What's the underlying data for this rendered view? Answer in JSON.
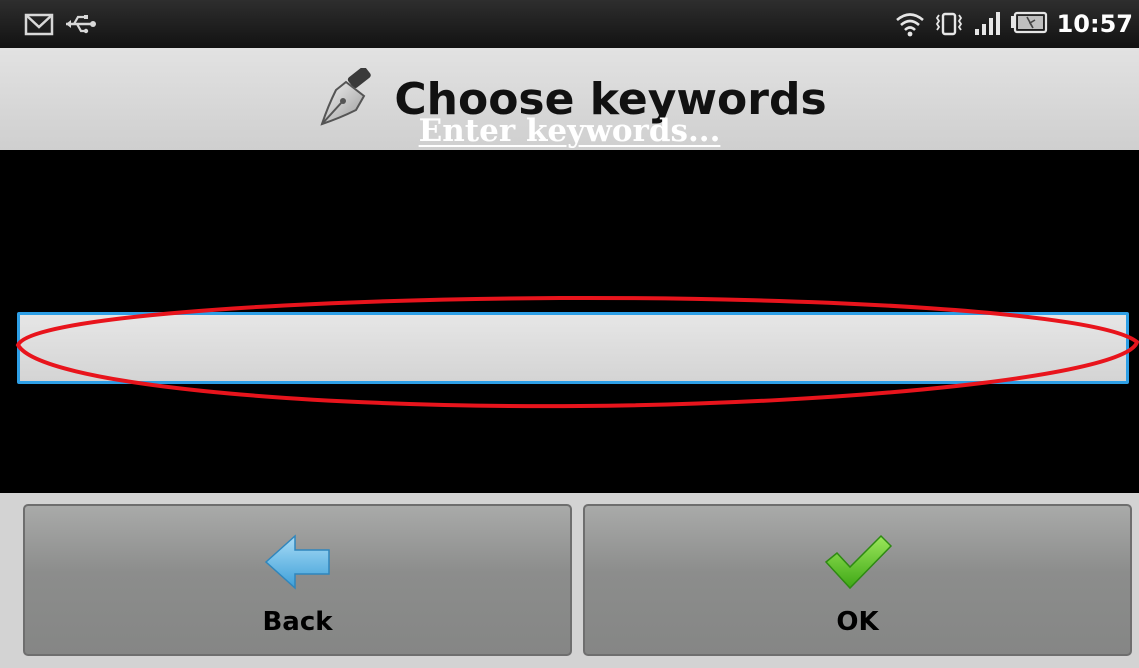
{
  "status_bar": {
    "time": "10:57",
    "notification_icons": [
      "gmail-icon",
      "usb-icon"
    ],
    "system_icons": [
      "wifi-icon",
      "vibrate-icon",
      "signal-icon",
      "battery-icon"
    ]
  },
  "title_bar": {
    "title": "Choose keywords",
    "icon": "pen-nib-icon"
  },
  "main": {
    "prompt": "Enter keywords...",
    "keyword_input_value": ""
  },
  "buttons": {
    "back_label": "Back",
    "ok_label": "OK"
  },
  "colors": {
    "input_border": "#2e9fe6",
    "annotation": "#e8141c",
    "ok_check": "#5cbf22",
    "back_arrow": "#5bb8e8"
  }
}
